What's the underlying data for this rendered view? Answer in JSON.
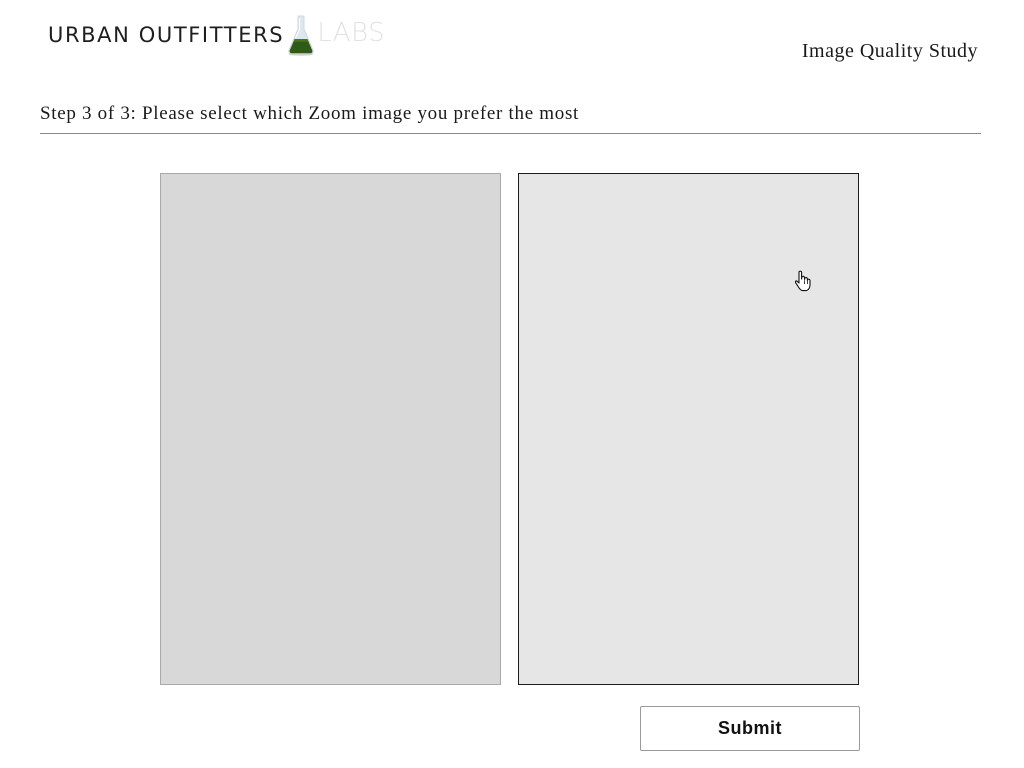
{
  "header": {
    "logo": {
      "brand_text": "URBAN OUTFITTERS",
      "labs_text": "LABS",
      "icon": "flask-icon"
    },
    "study_title": "Image Quality Study"
  },
  "main": {
    "step_title": "Step 3 of 3: Please select which Zoom image you prefer the most",
    "options": [
      {
        "name": "zoom-image-option-a",
        "selected": false
      },
      {
        "name": "zoom-image-option-b",
        "selected": true
      }
    ],
    "submit_label": "Submit"
  },
  "cursor": {
    "icon": "hand-pointer-icon"
  },
  "colors": {
    "flask_liquid": "#2f5a17",
    "labs_text": "#e2e2e2",
    "option_a_fill": "#d8d8d8",
    "option_b_fill": "#e6e6e6"
  }
}
